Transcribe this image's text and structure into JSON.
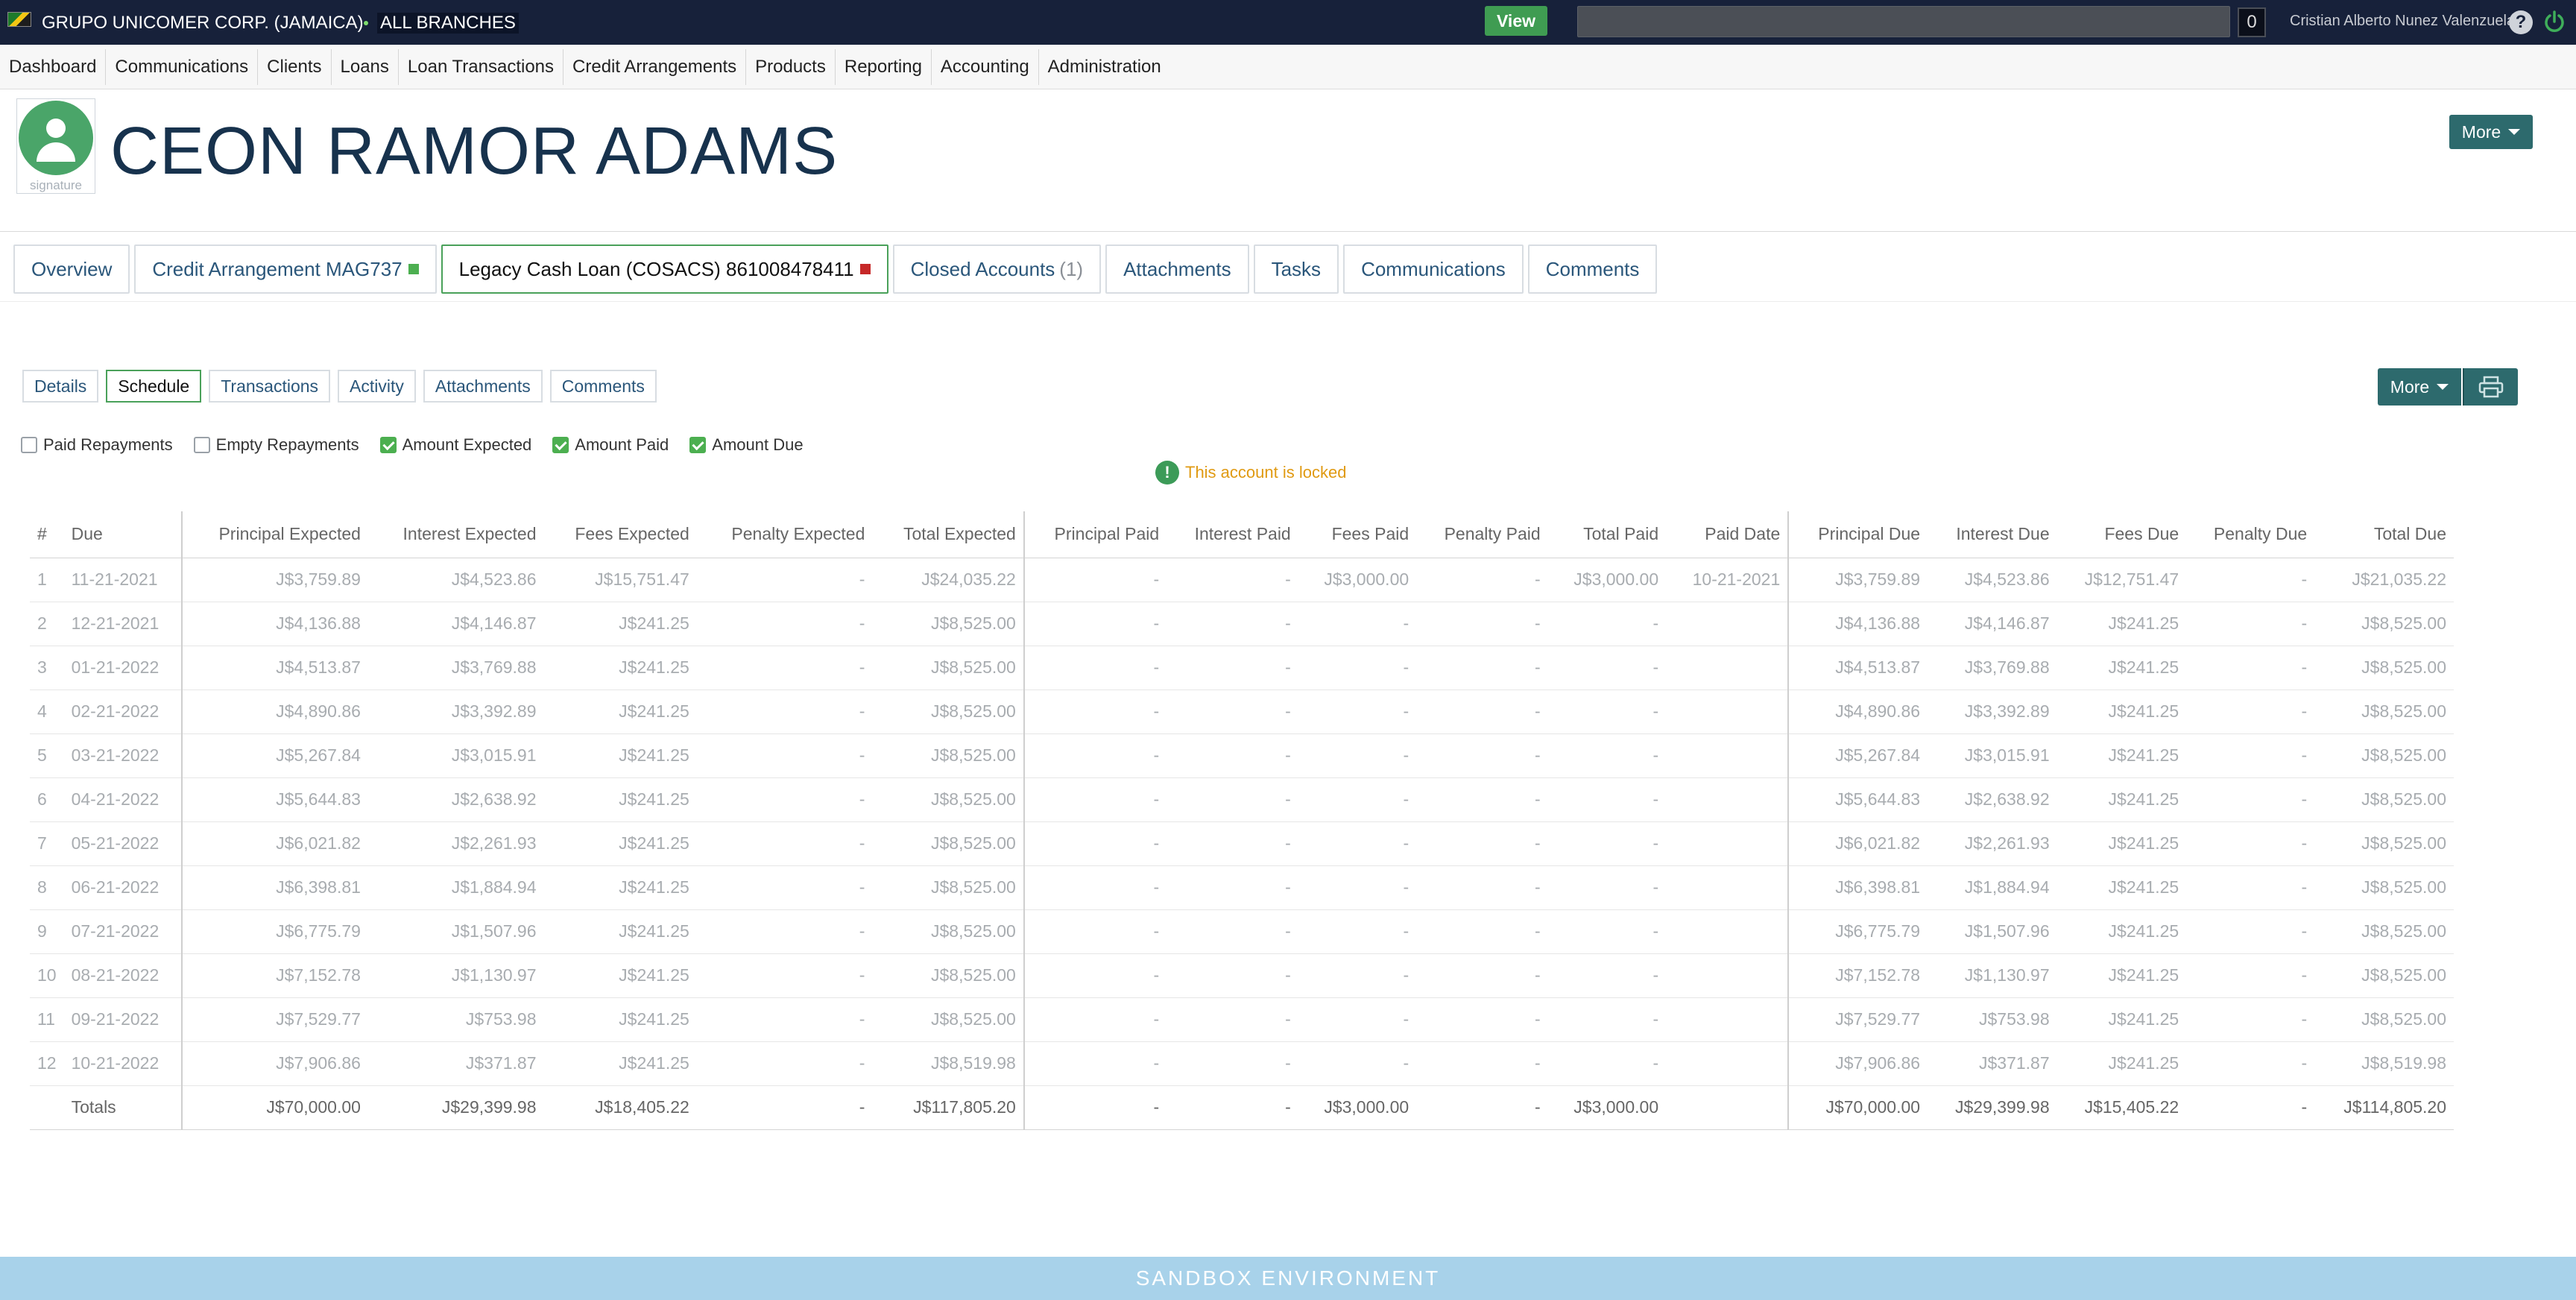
{
  "topbar": {
    "org": "GRUPO UNICOMER CORP. (JAMAICA)",
    "branch": "ALL BRANCHES",
    "view_label": "View",
    "search_value": "",
    "count": "0",
    "user": "Cristian Alberto Nunez Valenzuela"
  },
  "nav": [
    "Dashboard",
    "Communications",
    "Clients",
    "Loans",
    "Loan Transactions",
    "Credit Arrangements",
    "Products",
    "Reporting",
    "Accounting",
    "Administration"
  ],
  "client": {
    "name": "CEON RAMOR ADAMS",
    "signature_label": "signature",
    "more_label": "More"
  },
  "account_tabs": {
    "overview": "Overview",
    "credit": "Credit Arrangement MAG737",
    "legacy": "Legacy Cash Loan (COSACS) 861008478411",
    "closed": "Closed Accounts",
    "closed_count": "(1)",
    "attachments": "Attachments",
    "tasks": "Tasks",
    "communications": "Communications",
    "comments": "Comments"
  },
  "sub_tabs": {
    "details": "Details",
    "schedule": "Schedule",
    "transactions": "Transactions",
    "activity": "Activity",
    "attachments": "Attachments",
    "comments": "Comments",
    "more": "More"
  },
  "filters": {
    "paid": "Paid Repayments",
    "empty": "Empty Repayments",
    "expected": "Amount Expected",
    "amount_paid": "Amount Paid",
    "due": "Amount Due"
  },
  "lock_message": "This account is locked",
  "table": {
    "headers": [
      "#",
      "Due",
      "Principal Expected",
      "Interest Expected",
      "Fees Expected",
      "Penalty Expected",
      "Total Expected",
      "Principal Paid",
      "Interest Paid",
      "Fees Paid",
      "Penalty Paid",
      "Total Paid",
      "Paid Date",
      "Principal Due",
      "Interest Due",
      "Fees Due",
      "Penalty Due",
      "Total Due"
    ],
    "rows": [
      [
        "1",
        "11-21-2021",
        "J$3,759.89",
        "J$4,523.86",
        "J$15,751.47",
        "-",
        "J$24,035.22",
        "-",
        "-",
        "J$3,000.00",
        "-",
        "J$3,000.00",
        "10-21-2021",
        "J$3,759.89",
        "J$4,523.86",
        "J$12,751.47",
        "-",
        "J$21,035.22"
      ],
      [
        "2",
        "12-21-2021",
        "J$4,136.88",
        "J$4,146.87",
        "J$241.25",
        "-",
        "J$8,525.00",
        "-",
        "-",
        "-",
        "-",
        "-",
        "",
        "J$4,136.88",
        "J$4,146.87",
        "J$241.25",
        "-",
        "J$8,525.00"
      ],
      [
        "3",
        "01-21-2022",
        "J$4,513.87",
        "J$3,769.88",
        "J$241.25",
        "-",
        "J$8,525.00",
        "-",
        "-",
        "-",
        "-",
        "-",
        "",
        "J$4,513.87",
        "J$3,769.88",
        "J$241.25",
        "-",
        "J$8,525.00"
      ],
      [
        "4",
        "02-21-2022",
        "J$4,890.86",
        "J$3,392.89",
        "J$241.25",
        "-",
        "J$8,525.00",
        "-",
        "-",
        "-",
        "-",
        "-",
        "",
        "J$4,890.86",
        "J$3,392.89",
        "J$241.25",
        "-",
        "J$8,525.00"
      ],
      [
        "5",
        "03-21-2022",
        "J$5,267.84",
        "J$3,015.91",
        "J$241.25",
        "-",
        "J$8,525.00",
        "-",
        "-",
        "-",
        "-",
        "-",
        "",
        "J$5,267.84",
        "J$3,015.91",
        "J$241.25",
        "-",
        "J$8,525.00"
      ],
      [
        "6",
        "04-21-2022",
        "J$5,644.83",
        "J$2,638.92",
        "J$241.25",
        "-",
        "J$8,525.00",
        "-",
        "-",
        "-",
        "-",
        "-",
        "",
        "J$5,644.83",
        "J$2,638.92",
        "J$241.25",
        "-",
        "J$8,525.00"
      ],
      [
        "7",
        "05-21-2022",
        "J$6,021.82",
        "J$2,261.93",
        "J$241.25",
        "-",
        "J$8,525.00",
        "-",
        "-",
        "-",
        "-",
        "-",
        "",
        "J$6,021.82",
        "J$2,261.93",
        "J$241.25",
        "-",
        "J$8,525.00"
      ],
      [
        "8",
        "06-21-2022",
        "J$6,398.81",
        "J$1,884.94",
        "J$241.25",
        "-",
        "J$8,525.00",
        "-",
        "-",
        "-",
        "-",
        "-",
        "",
        "J$6,398.81",
        "J$1,884.94",
        "J$241.25",
        "-",
        "J$8,525.00"
      ],
      [
        "9",
        "07-21-2022",
        "J$6,775.79",
        "J$1,507.96",
        "J$241.25",
        "-",
        "J$8,525.00",
        "-",
        "-",
        "-",
        "-",
        "-",
        "",
        "J$6,775.79",
        "J$1,507.96",
        "J$241.25",
        "-",
        "J$8,525.00"
      ],
      [
        "10",
        "08-21-2022",
        "J$7,152.78",
        "J$1,130.97",
        "J$241.25",
        "-",
        "J$8,525.00",
        "-",
        "-",
        "-",
        "-",
        "-",
        "",
        "J$7,152.78",
        "J$1,130.97",
        "J$241.25",
        "-",
        "J$8,525.00"
      ],
      [
        "11",
        "09-21-2022",
        "J$7,529.77",
        "J$753.98",
        "J$241.25",
        "-",
        "J$8,525.00",
        "-",
        "-",
        "-",
        "-",
        "-",
        "",
        "J$7,529.77",
        "J$753.98",
        "J$241.25",
        "-",
        "J$8,525.00"
      ],
      [
        "12",
        "10-21-2022",
        "J$7,906.86",
        "J$371.87",
        "J$241.25",
        "-",
        "J$8,519.98",
        "-",
        "-",
        "-",
        "-",
        "-",
        "",
        "J$7,906.86",
        "J$371.87",
        "J$241.25",
        "-",
        "J$8,519.98"
      ]
    ],
    "totals": [
      "",
      "Totals",
      "J$70,000.00",
      "J$29,399.98",
      "J$18,405.22",
      "-",
      "J$117,805.20",
      "-",
      "-",
      "J$3,000.00",
      "-",
      "J$3,000.00",
      "",
      "J$70,000.00",
      "J$29,399.98",
      "J$15,405.22",
      "-",
      "J$114,805.20"
    ]
  },
  "footer": "SANDBOX ENVIRONMENT",
  "colors": {
    "topbar": "#17213a",
    "accent_teal": "#2d6a6d",
    "active_green": "#4aa15a",
    "footer": "#a8d2ea"
  }
}
